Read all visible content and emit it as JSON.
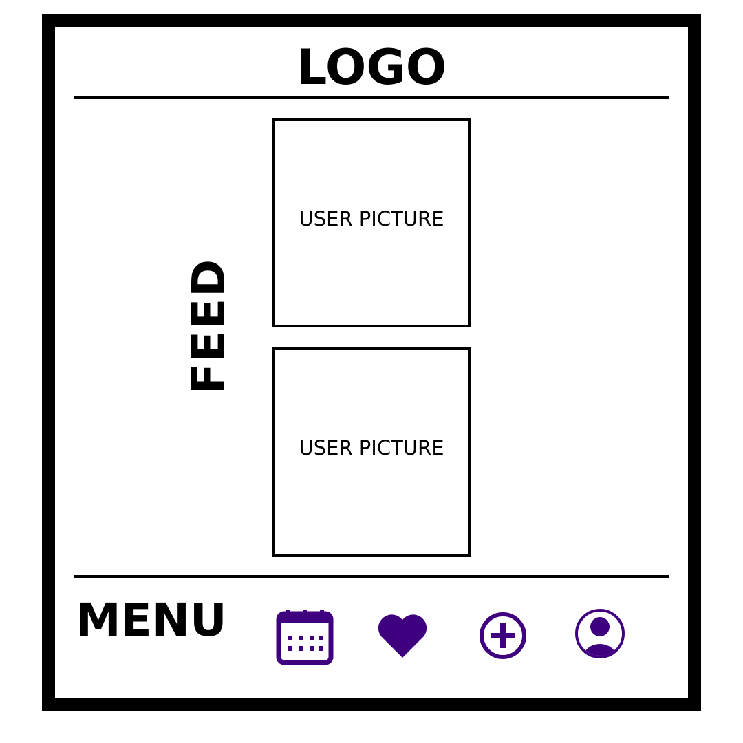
{
  "header": {
    "logo_text": "LOGO"
  },
  "feed": {
    "label": "FEED",
    "posts": [
      {
        "picture_label": "USER PICTURE"
      },
      {
        "picture_label": "USER PICTURE"
      }
    ]
  },
  "menu": {
    "label": "MENU",
    "icons": [
      "calendar-icon",
      "heart-icon",
      "plus-circle-icon",
      "user-profile-icon"
    ]
  },
  "colors": {
    "accent": "#3f0080",
    "border": "#000000",
    "background": "#ffffff"
  }
}
